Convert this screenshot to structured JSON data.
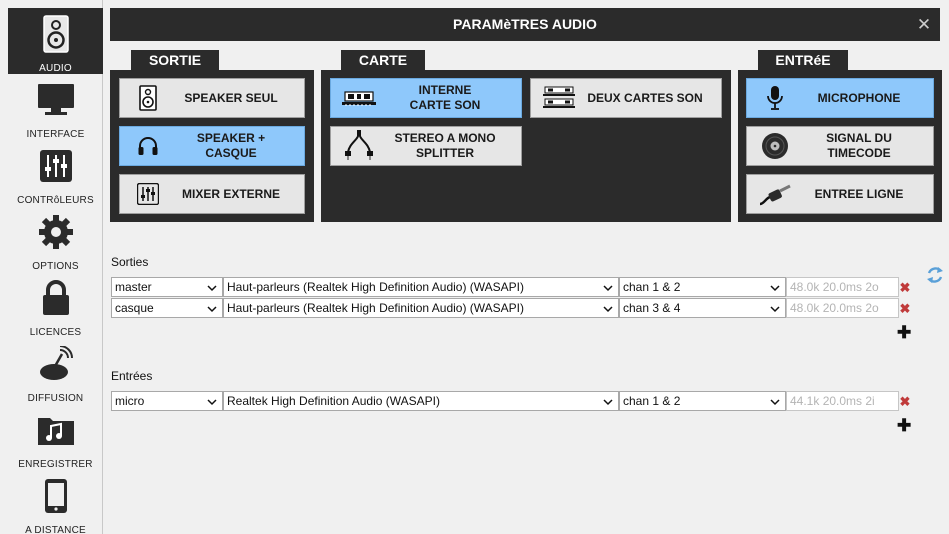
{
  "sidebar": {
    "items": [
      {
        "label": "AUDIO",
        "icon": "speaker-icon"
      },
      {
        "label": "INTERFACE",
        "icon": "monitor-icon"
      },
      {
        "label": "CONTRôLEURS",
        "icon": "sliders-icon"
      },
      {
        "label": "OPTIONS",
        "icon": "gear-icon"
      },
      {
        "label": "LICENCES",
        "icon": "lock-icon"
      },
      {
        "label": "DIFFUSION",
        "icon": "broadcast-icon"
      },
      {
        "label": "ENREGISTRER",
        "icon": "music-folder-icon"
      },
      {
        "label": "A DISTANCE",
        "icon": "phone-icon"
      }
    ],
    "active": "AUDIO"
  },
  "window": {
    "title": "PARAMèTRES AUDIO",
    "close_glyph": "✕"
  },
  "sortie": {
    "title": "SORTIE",
    "options": [
      {
        "label": "SPEAKER SEUL",
        "icon": "speaker-icon",
        "selected": false
      },
      {
        "label": "SPEAKER +\nCASQUE",
        "icon": "headphones-icon",
        "selected": true
      },
      {
        "label": "MIXER EXTERNE",
        "icon": "mixer-icon",
        "selected": false
      }
    ]
  },
  "carte": {
    "title": "CARTE",
    "options": [
      {
        "label": "INTERNE\nCARTE SON",
        "icon": "soundcard-icon",
        "selected": true
      },
      {
        "label": "DEUX CARTES SON",
        "icon": "dual-soundcard-icon",
        "selected": false
      },
      {
        "label": "STEREO A MONO\nSPLITTER",
        "icon": "splitter-cable-icon",
        "selected": false
      }
    ]
  },
  "entree": {
    "title": "ENTRéE",
    "options": [
      {
        "label": "MICROPHONE",
        "icon": "microphone-icon",
        "selected": true
      },
      {
        "label": "SIGNAL DU TIMECODE",
        "icon": "vinyl-icon",
        "selected": false
      },
      {
        "label": "ENTREE LIGNE",
        "icon": "jack-icon",
        "selected": false
      }
    ]
  },
  "outputs": {
    "label": "Sorties",
    "rows": [
      {
        "name": "master",
        "device": "Haut-parleurs (Realtek High Definition Audio) (WASAPI)",
        "channels": "chan 1 & 2",
        "info": "48.0k 20.0ms 2o"
      },
      {
        "name": "casque",
        "device": "Haut-parleurs (Realtek High Definition Audio) (WASAPI)",
        "channels": "chan 3 & 4",
        "info": "48.0k 20.0ms 2o"
      }
    ]
  },
  "inputs": {
    "label": "Entrées",
    "rows": [
      {
        "name": "micro",
        "device": "Realtek High Definition Audio (WASAPI)",
        "channels": "chan 1 & 2",
        "info": "44.1k 20.0ms 2i"
      }
    ]
  },
  "controls": {
    "delete_glyph": "✖",
    "add_glyph": "✚",
    "chevron_glyph": "⌄"
  },
  "colors": {
    "dark": "#2b2b2b",
    "selected": "#8ec8fb",
    "delete": "#c03a3a"
  }
}
